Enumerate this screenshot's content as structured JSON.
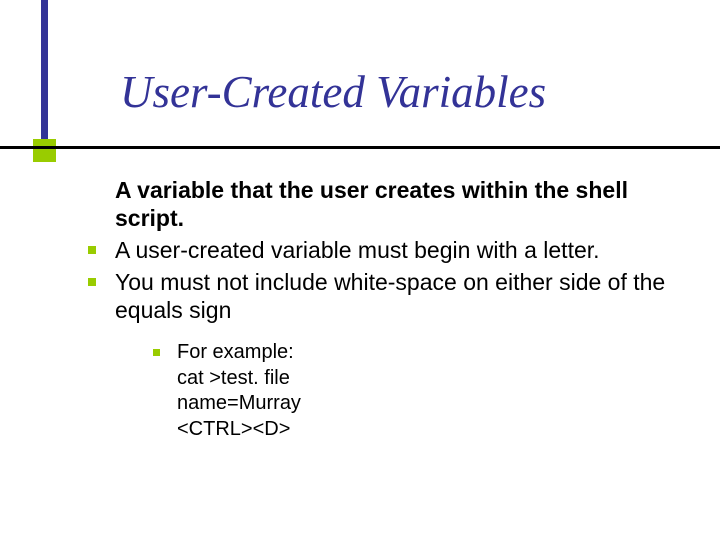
{
  "title": "User-Created Variables",
  "lead": "A variable that the user creates within the shell script.",
  "bullets": [
    "A user-created variable must begin with a letter.",
    "You must not include white-space on either side of the equals sign"
  ],
  "sub": [
    "For example:",
    "cat >test. file",
    "name=Murray",
    "<CTRL><D>"
  ],
  "colors": {
    "accent": "#333397",
    "bullet": "#99cc00"
  }
}
